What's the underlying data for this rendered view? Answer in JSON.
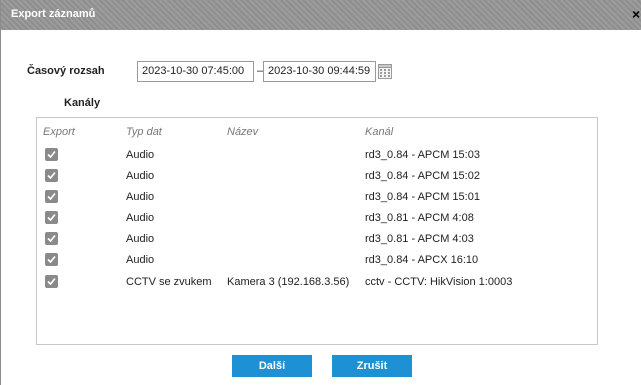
{
  "dialog": {
    "title": "Export záznamů",
    "close_glyph": "×"
  },
  "range": {
    "label": "Časový rozsah",
    "from": "2023-10-30 07:45:00",
    "separator": "–",
    "to": "2023-10-30 09:44:59",
    "calendar_icon": "calendar-icon"
  },
  "channels_label": "Kanály",
  "table": {
    "headers": {
      "export": "Export",
      "type": "Typ dat",
      "name": "Název",
      "channel": "Kanál"
    },
    "rows": [
      {
        "checked": true,
        "type": "Audio",
        "name": "",
        "channel": "rd3_0.84 - APCM 15:03"
      },
      {
        "checked": true,
        "type": "Audio",
        "name": "",
        "channel": "rd3_0.84 - APCM 15:02"
      },
      {
        "checked": true,
        "type": "Audio",
        "name": "",
        "channel": "rd3_0.84 - APCM 15:01"
      },
      {
        "checked": true,
        "type": "Audio",
        "name": "",
        "channel": "rd3_0.81 - APCM 4:08"
      },
      {
        "checked": true,
        "type": "Audio",
        "name": "",
        "channel": "rd3_0.81 - APCM 4:03"
      },
      {
        "checked": true,
        "type": "Audio",
        "name": "",
        "channel": "rd3_0.84 - APCX 16:10"
      },
      {
        "checked": true,
        "type": "CCTV se zvukem",
        "name": "Kamera 3 (192.168.3.56)",
        "channel": "cctv - CCTV: HikVision 1:0003"
      }
    ]
  },
  "buttons": {
    "next": "Další",
    "cancel": "Zrušit"
  },
  "colors": {
    "accent": "#1e90d4",
    "titlebar": "#959595",
    "checkbox": "#8a8a8a"
  }
}
